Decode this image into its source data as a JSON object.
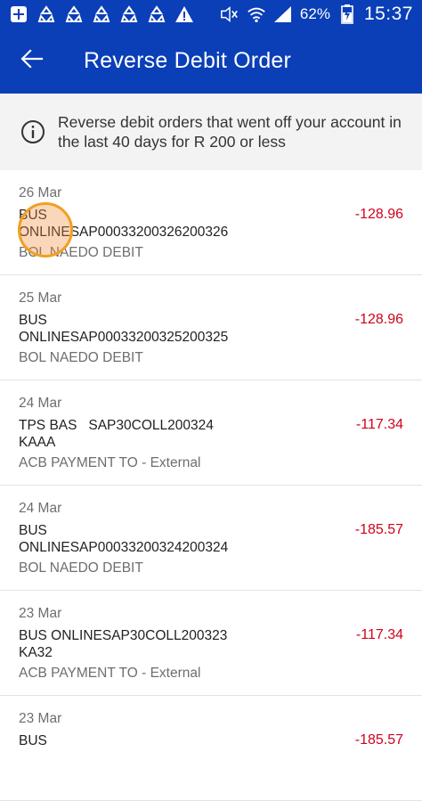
{
  "status_bar": {
    "battery": "62%",
    "time": "15:37",
    "icons": [
      "plus-box-icon",
      "sync-icon",
      "sync-icon",
      "sync-icon",
      "sync-icon",
      "sync-icon",
      "warning-icon",
      "mute-icon",
      "wifi-icon",
      "signal-icon",
      "battery-charging-icon"
    ]
  },
  "app_bar": {
    "title": "Reverse Debit Order",
    "back_icon": "arrow-left-icon"
  },
  "info": {
    "icon": "info-circle-icon",
    "text": "Reverse debit orders that went off your account in the last 40 days for R 200 or less"
  },
  "transactions": [
    {
      "date": "26 Mar",
      "description": "BUS\nONLINESAP00033200326200326",
      "type": "BOL NAEDO DEBIT",
      "amount": "-128.96"
    },
    {
      "date": "25 Mar",
      "description": "BUS\nONLINESAP00033200325200325",
      "type": "BOL NAEDO DEBIT",
      "amount": "-128.96"
    },
    {
      "date": "24 Mar",
      "description": "TPS BAS   SAP30COLL200324\nKAAA",
      "type": "ACB PAYMENT TO - External",
      "amount": "-117.34"
    },
    {
      "date": "24 Mar",
      "description": "BUS\nONLINESAP00033200324200324",
      "type": "BOL NAEDO DEBIT",
      "amount": "-185.57"
    },
    {
      "date": "23 Mar",
      "description": "BUS ONLINESAP30COLL200323\nKA32",
      "type": "ACB PAYMENT TO - External",
      "amount": "-117.34"
    },
    {
      "date": "23 Mar",
      "description": "BUS",
      "type": "",
      "amount": "-185.57"
    }
  ],
  "colors": {
    "primary": "#0a3fb8",
    "negative_amount": "#d0021b",
    "info_bg": "#f3f3f3"
  }
}
